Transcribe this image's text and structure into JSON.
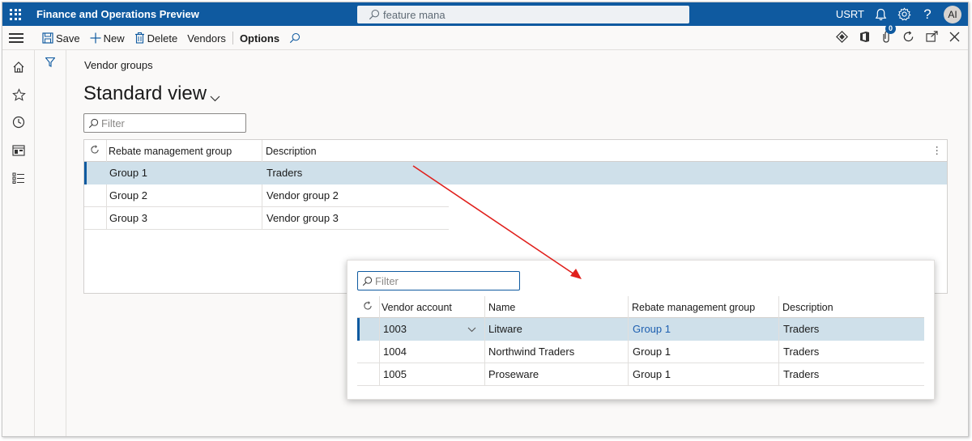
{
  "app": {
    "title": "Finance and Operations Preview",
    "search_value": "feature mana",
    "company": "USRT",
    "avatar_initials": "AI"
  },
  "toolbar": {
    "save_label": "Save",
    "new_label": "New",
    "delete_label": "Delete",
    "vendors_label": "Vendors",
    "options_label": "Options",
    "notification_count": "0"
  },
  "page": {
    "breadcrumb": "Vendor groups",
    "view_title": "Standard view",
    "filter_placeholder": "Filter"
  },
  "grid": {
    "columns": [
      "Rebate management group",
      "Description"
    ],
    "rows": [
      {
        "group": "Group 1",
        "description": "Traders",
        "selected": true
      },
      {
        "group": "Group 2",
        "description": "Vendor group 2",
        "selected": false
      },
      {
        "group": "Group 3",
        "description": "Vendor group 3",
        "selected": false
      }
    ]
  },
  "vendor_grid": {
    "filter_placeholder": "Filter",
    "columns": [
      "Vendor account",
      "Name",
      "Rebate management group",
      "Description"
    ],
    "rows": [
      {
        "account": "1003",
        "name": "Litware",
        "group": "Group 1",
        "description": "Traders",
        "selected": true
      },
      {
        "account": "1004",
        "name": "Northwind Traders",
        "group": "Group 1",
        "description": "Traders",
        "selected": false
      },
      {
        "account": "1005",
        "name": "Proseware",
        "group": "Group 1",
        "description": "Traders",
        "selected": false
      }
    ]
  },
  "colors": {
    "brand": "#0f5aa0",
    "selected_row": "#cfe0ea",
    "link": "#1d5fb0",
    "arrow": "#e0201c"
  },
  "icons": [
    "waffle-icon",
    "search-icon",
    "bell-icon",
    "gear-icon",
    "help-icon",
    "hamburger-icon",
    "save-icon",
    "plus-icon",
    "trash-icon",
    "diamond-icon",
    "office-icon",
    "attachment-icon",
    "refresh-icon",
    "open-new-icon",
    "close-icon",
    "home-icon",
    "star-icon",
    "clock-icon",
    "workspace-icon",
    "list-icon",
    "filter-icon",
    "chevron-down-icon",
    "more-icon"
  ]
}
